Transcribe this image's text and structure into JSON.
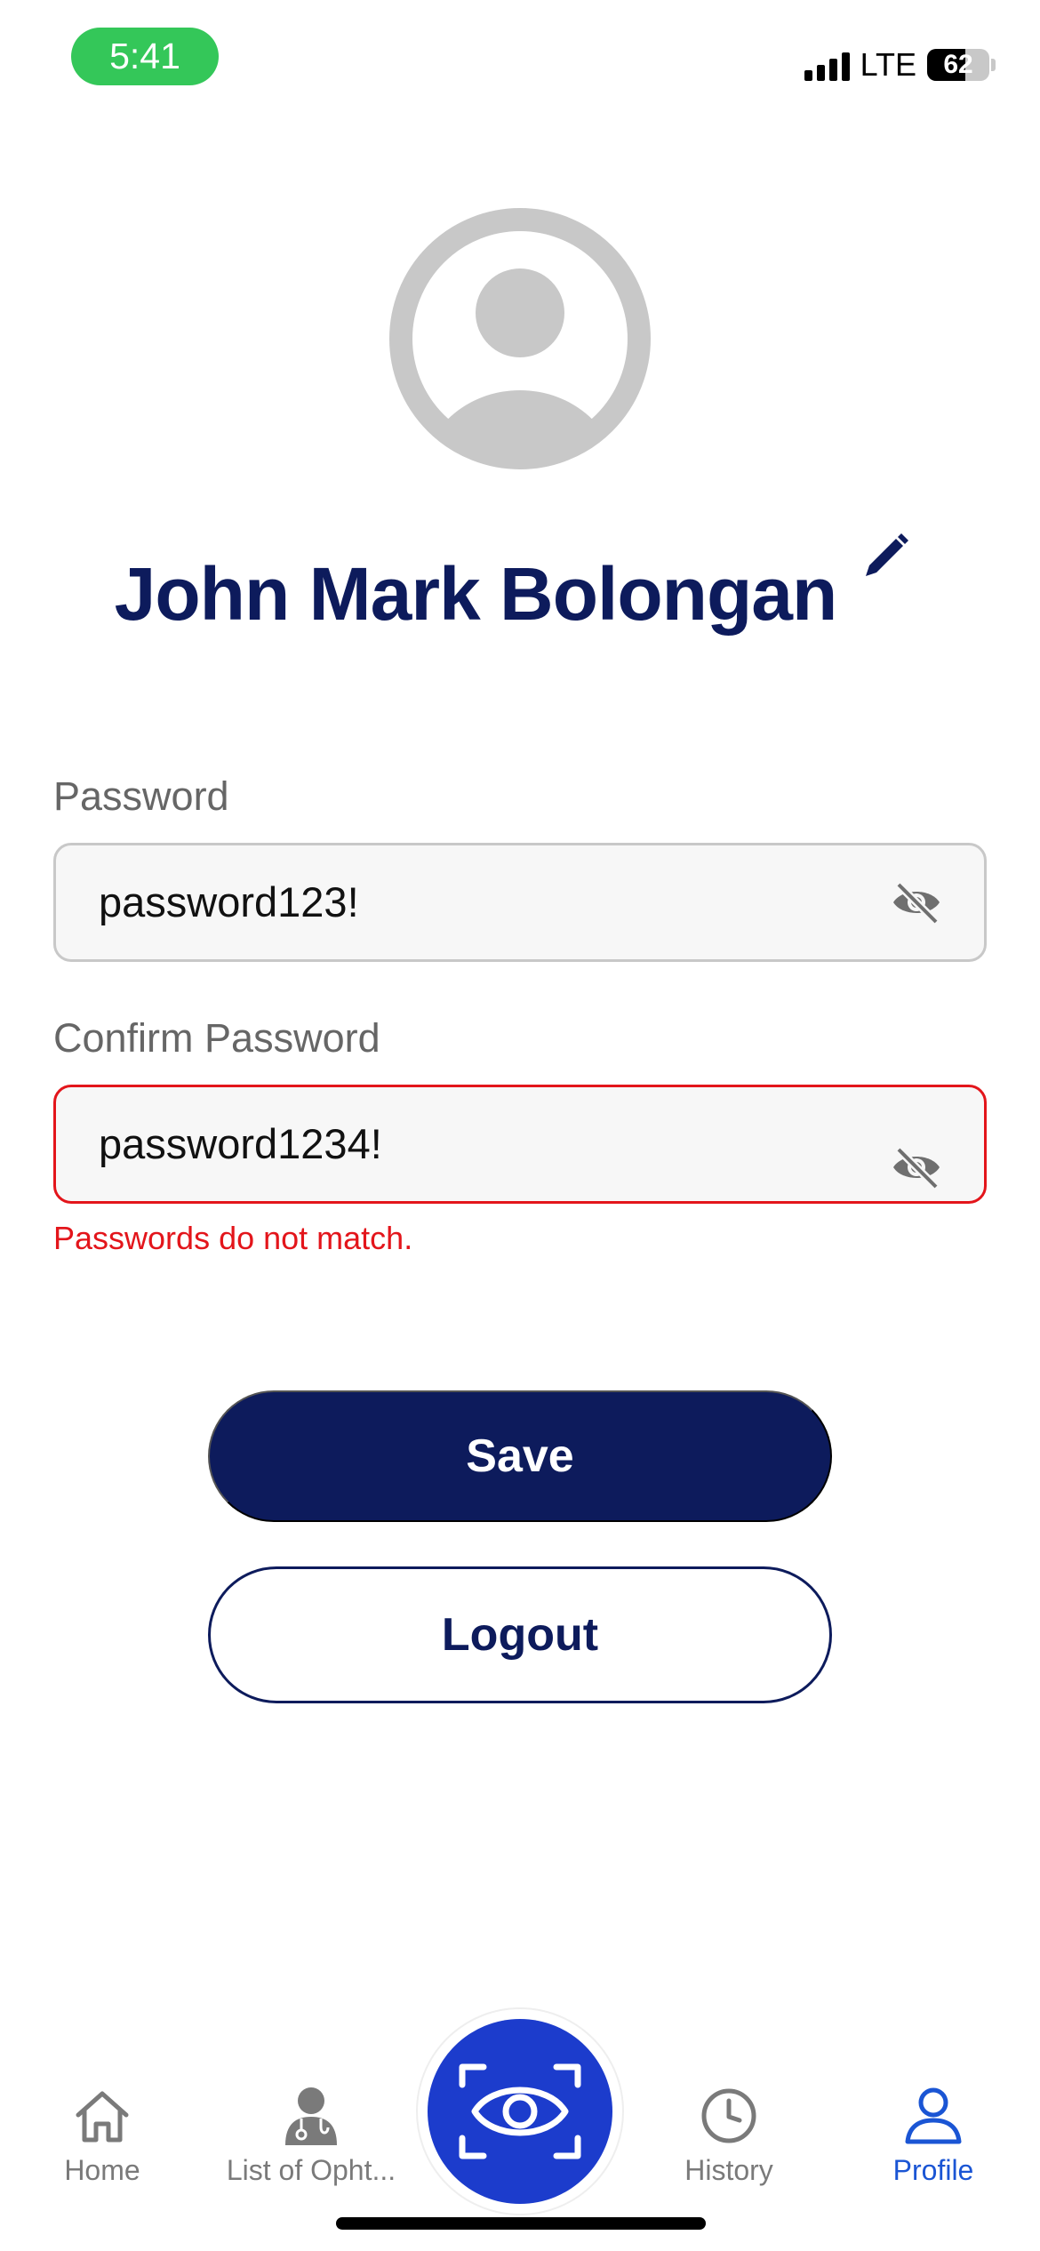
{
  "status_bar": {
    "time": "5:41",
    "network": "LTE",
    "battery": "62",
    "battery_level_percent": 62
  },
  "profile": {
    "name": "John Mark Bolongan"
  },
  "form": {
    "password_label": "Password",
    "password_value": "password123!",
    "confirm_label": "Confirm Password",
    "confirm_value": "password1234!",
    "error_message": "Passwords do not match."
  },
  "actions": {
    "save_label": "Save",
    "logout_label": "Logout"
  },
  "nav": {
    "items": [
      {
        "label": "Home",
        "icon": "home-icon",
        "active": false
      },
      {
        "label": "List of Opht...",
        "icon": "doctor-icon",
        "active": false
      },
      {
        "label": "",
        "icon": "eye-scan-icon",
        "active": false
      },
      {
        "label": "History",
        "icon": "clock-icon",
        "active": false
      },
      {
        "label": "Profile",
        "icon": "person-icon",
        "active": true
      }
    ]
  },
  "colors": {
    "primary_navy": "#0d1b5c",
    "accent_blue": "#1c3ccc",
    "active_tab": "#1a55d4",
    "error_red": "#e3151b",
    "status_green": "#34c759"
  }
}
